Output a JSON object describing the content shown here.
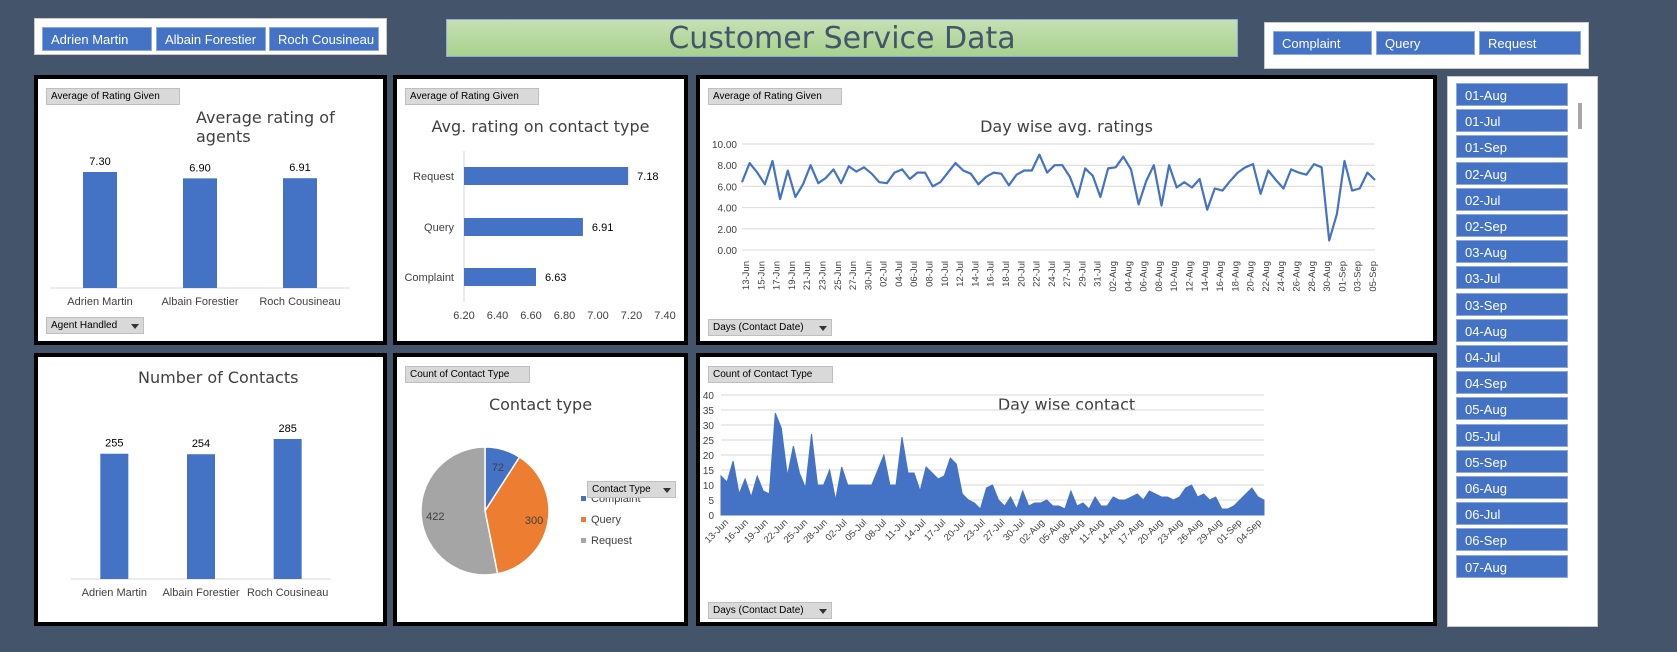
{
  "title": "Customer Service Data",
  "agent_slicer": [
    "Adrien Martin",
    "Albain Forestier",
    "Roch Cousineau"
  ],
  "type_slicer": [
    "Complaint",
    "Query",
    "Request"
  ],
  "date_slicer": [
    "01-Aug",
    "01-Jul",
    "01-Sep",
    "02-Aug",
    "02-Jul",
    "02-Sep",
    "03-Aug",
    "03-Jul",
    "03-Sep",
    "04-Aug",
    "04-Jul",
    "04-Sep",
    "05-Aug",
    "05-Jul",
    "05-Sep",
    "06-Aug",
    "06-Jul",
    "06-Sep",
    "07-Aug"
  ],
  "field_buttons": {
    "avg_rating": "Average of Rating Given",
    "agent_handled": "Agent Handled",
    "days": "Days (Contact Date)",
    "count_type": "Count of Contact Type",
    "contact_type": "Contact Type"
  },
  "colors": {
    "bar": "#4472c4",
    "orange": "#ed7d31",
    "gray": "#a5a5a5",
    "background": "#44546a"
  },
  "chart_data": [
    {
      "type": "bar",
      "title": "Average rating of agents",
      "categories": [
        "Adrien Martin",
        "Albain Forestier",
        "Roch Cousineau"
      ],
      "values": [
        7.3,
        6.9,
        6.91
      ],
      "data_labels": [
        "7.30",
        "6.90",
        "6.91"
      ]
    },
    {
      "type": "bar",
      "orientation": "horizontal",
      "title": "Avg. rating on contact type",
      "categories": [
        "Request",
        "Query",
        "Complaint"
      ],
      "values": [
        7.18,
        6.91,
        6.63
      ],
      "data_labels": [
        "7.18",
        "6.91",
        "6.63"
      ],
      "xlim": [
        6.2,
        7.4
      ],
      "xticks": [
        "6.20",
        "6.40",
        "6.60",
        "6.80",
        "7.00",
        "7.20",
        "7.40"
      ]
    },
    {
      "type": "line",
      "title": "Day wise avg. ratings",
      "ylim": [
        0,
        10
      ],
      "yticks": [
        "0.00",
        "2.00",
        "4.00",
        "6.00",
        "8.00",
        "10.00"
      ],
      "xticks": [
        "13-Jun",
        "15-Jun",
        "17-Jun",
        "19-Jun",
        "21-Jun",
        "23-Jun",
        "25-Jun",
        "27-Jun",
        "30-Jun",
        "02-Jul",
        "04-Jul",
        "06-Jul",
        "08-Jul",
        "10-Jul",
        "12-Jul",
        "14-Jul",
        "16-Jul",
        "18-Jul",
        "20-Jul",
        "22-Jul",
        "24-Jul",
        "27-Jul",
        "29-Jul",
        "31-Jul",
        "02-Aug",
        "04-Aug",
        "06-Aug",
        "08-Aug",
        "10-Aug",
        "12-Aug",
        "14-Aug",
        "16-Aug",
        "18-Aug",
        "20-Aug",
        "22-Aug",
        "24-Aug",
        "26-Aug",
        "28-Aug",
        "30-Aug",
        "01-Sep",
        "03-Sep",
        "05-Sep"
      ],
      "grid": true,
      "values": [
        6.4,
        8.2,
        7.3,
        6.2,
        8.4,
        4.8,
        7.5,
        5.0,
        6.2,
        8.0,
        6.3,
        6.8,
        7.6,
        6.3,
        7.9,
        7.4,
        7.8,
        7.2,
        6.4,
        6.3,
        7.3,
        7.6,
        6.7,
        7.3,
        7.3,
        6.0,
        6.4,
        7.3,
        8.2,
        7.5,
        7.2,
        6.2,
        6.9,
        7.3,
        7.2,
        6.1,
        7.1,
        7.5,
        7.5,
        9.0,
        7.3,
        8.0,
        8.0,
        6.9,
        5.0,
        7.7,
        7.0,
        5.0,
        7.7,
        7.8,
        8.8,
        7.6,
        4.3,
        6.5,
        8.0,
        4.2,
        8.0,
        5.9,
        6.4,
        5.9,
        6.7,
        3.8,
        5.8,
        5.6,
        6.5,
        7.3,
        7.8,
        8.1,
        5.3,
        7.5,
        6.6,
        5.8,
        7.6,
        7.3,
        7.1,
        8.1,
        7.8,
        0.9,
        3.4,
        8.4,
        5.6,
        5.8,
        7.3,
        6.6
      ]
    },
    {
      "type": "bar",
      "title": "Number of Contacts",
      "categories": [
        "Adrien Martin",
        "Albain Forestier",
        "Roch Cousineau"
      ],
      "values": [
        255,
        254,
        285
      ],
      "data_labels": [
        "255",
        "254",
        "285"
      ]
    },
    {
      "type": "pie",
      "title": "Contact type",
      "categories": [
        "Complaint",
        "Query",
        "Request"
      ],
      "values": [
        72,
        300,
        422
      ],
      "data_labels": [
        "72",
        "300",
        "422"
      ],
      "legend_title": "Contact Type",
      "legend": "right"
    },
    {
      "type": "area",
      "title": "Day wise contact",
      "ylim": [
        0,
        40
      ],
      "yticks": [
        "0",
        "5",
        "10",
        "15",
        "20",
        "25",
        "30",
        "35",
        "40"
      ],
      "xticks": [
        "13-Jun",
        "16-Jun",
        "19-Jun",
        "22-Jun",
        "25-Jun",
        "28-Jun",
        "02-Jul",
        "05-Jul",
        "08-Jul",
        "11-Jul",
        "14-Jul",
        "17-Jul",
        "20-Jul",
        "23-Jul",
        "27-Jul",
        "30-Jul",
        "02-Aug",
        "05-Aug",
        "08-Aug",
        "11-Aug",
        "14-Aug",
        "17-Aug",
        "20-Aug",
        "23-Aug",
        "26-Aug",
        "29-Aug",
        "01-Sep",
        "04-Sep"
      ],
      "grid": true,
      "values": [
        13,
        11,
        18,
        7,
        12,
        6,
        13,
        8,
        7,
        34,
        29,
        13,
        23,
        14,
        9,
        27,
        10,
        10,
        15,
        5,
        16,
        10,
        10,
        10,
        10,
        10,
        15,
        20,
        10,
        10,
        26,
        14,
        14,
        8,
        16,
        14,
        12,
        13,
        19,
        17,
        7,
        5,
        4,
        2,
        9,
        10,
        5,
        3,
        6,
        2,
        8,
        3,
        4,
        4,
        5,
        3,
        3,
        2,
        8,
        3,
        4,
        2,
        6,
        3,
        3,
        6,
        5,
        5,
        6,
        7,
        5,
        8,
        7,
        6,
        6,
        5,
        6,
        9,
        10,
        6,
        7,
        5,
        6,
        2,
        2,
        3,
        5,
        7,
        9,
        6,
        5
      ]
    }
  ]
}
